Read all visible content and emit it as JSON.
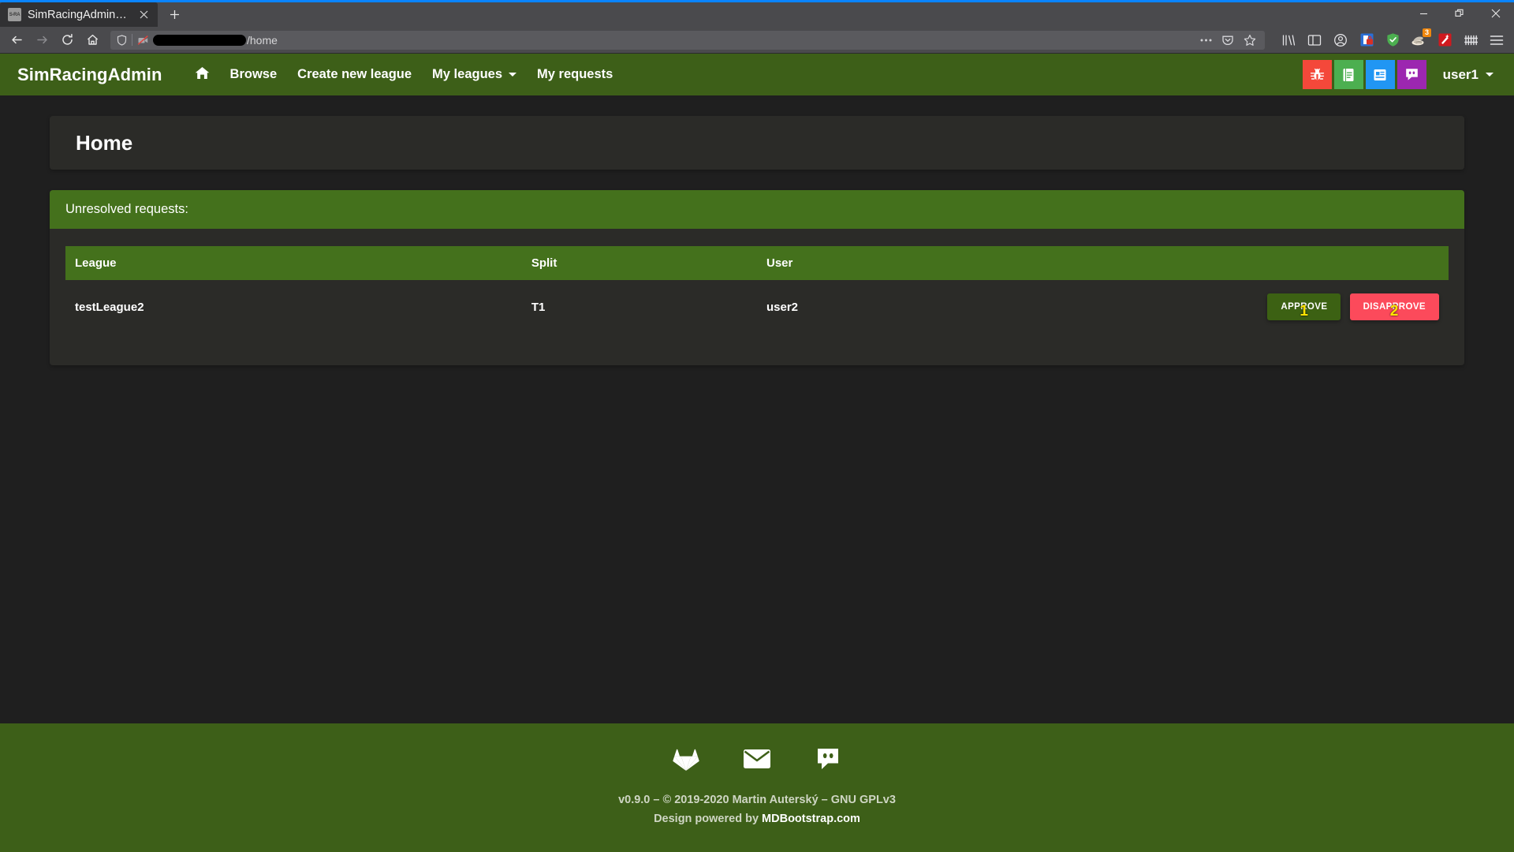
{
  "browser": {
    "tab": {
      "title": "SimRacingAdmin - Home",
      "favicon_text": "S-RA",
      "favicon_icon": "page-favicon",
      "close_icon": "close-icon"
    },
    "newtab_icon": "plus-icon",
    "window_controls": {
      "minimize_icon": "minimize-icon",
      "restore_icon": "restore-icon",
      "close_icon": "close-icon"
    },
    "nav": {
      "back_icon": "back-arrow-icon",
      "forward_icon": "forward-arrow-icon",
      "reload_icon": "reload-icon",
      "home_icon": "home-icon"
    },
    "urlbar": {
      "shield_icon": "shield-icon",
      "permission_icon": "camera-blocked-icon",
      "redacted": "",
      "path": "/home",
      "ellipsis_icon": "page-actions-ellipsis-icon",
      "pocket_icon": "pocket-icon",
      "bookmark_icon": "star-icon"
    },
    "toolbar_icons": [
      {
        "name": "library-icon",
        "badge": ""
      },
      {
        "name": "sidebar-icon",
        "badge": ""
      },
      {
        "name": "account-icon",
        "badge": ""
      },
      {
        "name": "extension-lock-icon",
        "badge": ""
      },
      {
        "name": "shield-extension-icon",
        "badge": ""
      },
      {
        "name": "extension-badge-icon",
        "badge": "3"
      },
      {
        "name": "magic-wand-icon",
        "badge": ""
      },
      {
        "name": "grid-extension-icon",
        "badge": ""
      },
      {
        "name": "hamburger-menu-icon",
        "badge": ""
      }
    ]
  },
  "app": {
    "brand": "SimRacingAdmin",
    "nav_links": [
      {
        "label": "",
        "icon": "home-icon",
        "caret": false
      },
      {
        "label": "Browse",
        "icon": "",
        "caret": false
      },
      {
        "label": "Create new league",
        "icon": "",
        "caret": false
      },
      {
        "label": "My leagues",
        "icon": "",
        "caret": true
      },
      {
        "label": "My requests",
        "icon": "",
        "caret": false
      }
    ],
    "social_buttons": [
      {
        "name": "bug-report-icon",
        "color": "#f4483a"
      },
      {
        "name": "documentation-book-icon",
        "color": "#4caf50"
      },
      {
        "name": "changelog-article-icon",
        "color": "#2196f3"
      },
      {
        "name": "discord-icon",
        "color": "#9c27b0"
      }
    ],
    "user": {
      "label": "user1",
      "caret_icon": "chevron-down-icon"
    },
    "page_title": "Home",
    "requests_card": {
      "header": "Unresolved requests:",
      "columns": [
        "League",
        "Split",
        "User",
        ""
      ],
      "rows": [
        {
          "league": "testLeague2",
          "split": "T1",
          "user": "user2",
          "approve_label": "APPROVE",
          "approve_annotation": "1",
          "disapprove_label": "DISAPPROVE",
          "disapprove_annotation": "2"
        }
      ]
    },
    "footer": {
      "icons": [
        {
          "name": "gitlab-icon"
        },
        {
          "name": "email-icon"
        },
        {
          "name": "discord-icon"
        }
      ],
      "line1": "v0.9.0 – © 2019-2020 Martin Auterský – GNU GPLv3",
      "line2_prefix": "Design powered by ",
      "line2_link": "MDBootstrap.com"
    }
  },
  "colors": {
    "navbar_green": "#3d5f18",
    "accent_green": "#44711c",
    "approve_green": "#3c6113",
    "disapprove_red": "#fc4a5b",
    "card_bg": "#2b2b28",
    "page_bg": "#1f1f1f",
    "annotation_yellow": "#ffe400"
  }
}
